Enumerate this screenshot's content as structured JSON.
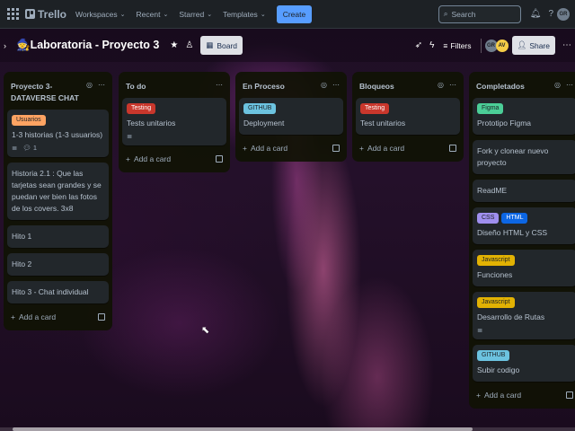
{
  "colors": {
    "nav_bg": "#1d2125",
    "create": "#579dff",
    "label_orange": "#fea362",
    "label_red": "#c9372c",
    "label_cyan": "#6cc3e0",
    "label_green": "#4bce97",
    "label_purple": "#9f8fef",
    "label_blue": "#0c66e4",
    "label_yellow": "#e2b203"
  },
  "topnav": {
    "brand": "Trello",
    "items": [
      "Workspaces",
      "Recent",
      "Starred",
      "Templates"
    ],
    "create": "Create",
    "search_placeholder": "Search",
    "avatar": "GR"
  },
  "boardbar": {
    "title": "Laboratoria - Proyecto 3",
    "view": "Board",
    "filters": "Filters",
    "avatar1": "GR",
    "avatar2": "AV",
    "share": "Share"
  },
  "lists": [
    {
      "title": "Proyecto 3- DATAVERSE CHAT",
      "cards": [
        {
          "labels": [
            {
              "text": "Usuarios",
              "color": "orange"
            }
          ],
          "text": "1-3 historias (1-3 usuarios)",
          "desc": true,
          "comments": "1"
        },
        {
          "labels": [],
          "text": "Historia 2.1 : Que las tarjetas sean grandes y se puedan ver bien las fotos de los covers. 3x8"
        },
        {
          "labels": [],
          "text": "Hito 1"
        },
        {
          "labels": [],
          "text": "Hito 2"
        },
        {
          "labels": [],
          "text": "Hito 3 - Chat individual"
        }
      ],
      "add": "Add a card"
    },
    {
      "title": "To do",
      "cards": [
        {
          "labels": [
            {
              "text": "Testing",
              "color": "red"
            }
          ],
          "text": "Tests unitarios",
          "desc": true
        }
      ],
      "add": "Add a card"
    },
    {
      "title": "En Proceso",
      "cards": [
        {
          "labels": [
            {
              "text": "GITHUB",
              "color": "cyan"
            }
          ],
          "text": "Deployment"
        }
      ],
      "add": "Add a card"
    },
    {
      "title": "Bloqueos",
      "cards": [
        {
          "labels": [
            {
              "text": "Testing",
              "color": "red"
            }
          ],
          "text": "Test unitarios"
        }
      ],
      "add": "Add a card"
    },
    {
      "title": "Completados",
      "cards": [
        {
          "labels": [
            {
              "text": "Figma",
              "color": "green"
            }
          ],
          "text": "Prototipo Figma"
        },
        {
          "labels": [],
          "text": "Fork y clonear nuevo proyecto"
        },
        {
          "labels": [],
          "text": "ReadME"
        },
        {
          "labels": [
            {
              "text": "CSS",
              "color": "purple"
            },
            {
              "text": "HTML",
              "color": "blue"
            }
          ],
          "text": "Diseño HTML y CSS"
        },
        {
          "labels": [
            {
              "text": "Javascript",
              "color": "yellow"
            }
          ],
          "text": "Funciones"
        },
        {
          "labels": [
            {
              "text": "Javascript",
              "color": "yellow"
            }
          ],
          "text": "Desarrollo de Rutas",
          "desc": true
        },
        {
          "labels": [
            {
              "text": "GITHUB",
              "color": "cyan"
            }
          ],
          "text": "Subir codigo"
        }
      ],
      "add": "Add a card"
    }
  ]
}
